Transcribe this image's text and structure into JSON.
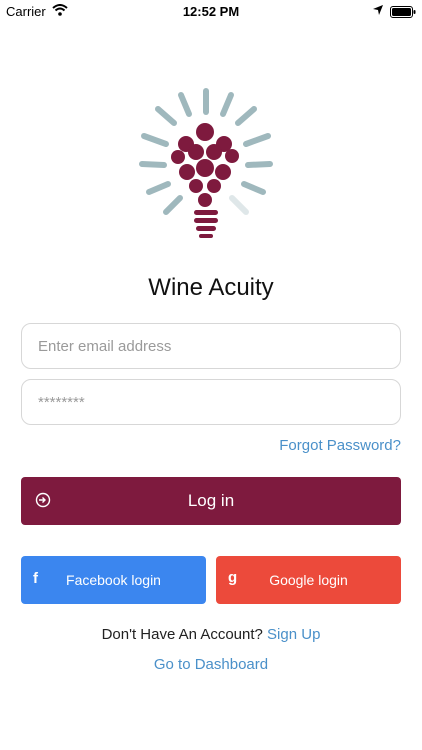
{
  "status_bar": {
    "carrier": "Carrier",
    "time": "12:52 PM",
    "icons": [
      "wifi-icon",
      "location-icon",
      "battery-icon"
    ]
  },
  "app": {
    "title": "Wine Acuity",
    "logo": "grape-lightbulb-logo"
  },
  "form": {
    "email_placeholder": "Enter email address",
    "email_value": "",
    "password_placeholder": "********",
    "password_value": "",
    "forgot_label": "Forgot Password?"
  },
  "buttons": {
    "login_label": "Log in",
    "facebook_label": "Facebook login",
    "facebook_icon_glyph": "f",
    "google_label": "Google login",
    "google_icon_glyph": "g"
  },
  "footer": {
    "no_account_text": "Don't Have An Account?",
    "signup_label": "Sign Up",
    "dashboard_label": "Go to Dashboard"
  },
  "colors": {
    "brand_wine": "#7e1a3e",
    "facebook_blue": "#3b86ef",
    "google_red": "#ec4a3b",
    "link_blue": "#4a90c9",
    "logo_rays": "#9fb8bd"
  }
}
